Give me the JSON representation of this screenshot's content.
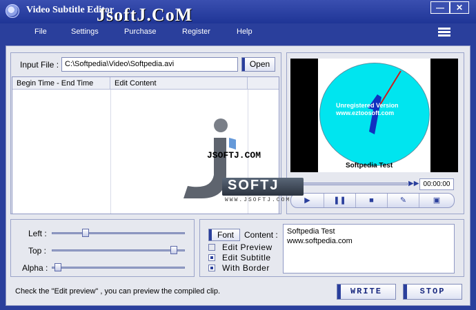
{
  "window": {
    "title": "Video Subtitle Editor",
    "watermark": "JsoftJ.CoM",
    "minimize_glyph": "—",
    "close_glyph": "✕"
  },
  "menu": {
    "items": [
      "File",
      "Settings",
      "Purchase",
      "Register",
      "Help"
    ]
  },
  "input": {
    "label": "Input File :",
    "value": "C:\\Softpedia\\Video\\Softpedia.avi",
    "open_label": "Open"
  },
  "table": {
    "columns": [
      "Begin Time - End Time",
      "Edit Content"
    ],
    "rows": []
  },
  "video": {
    "overlay_line1": "Unregistered Version",
    "overlay_line2": "www.eztoosoft.com",
    "caption": "Softpedia Test",
    "time": "00:00:00"
  },
  "watermark_logo": {
    "line1": "JSOFTJ.COM",
    "line2": "SOFTJ",
    "line3": "WWW.JSOFTJ.COM"
  },
  "sliders": {
    "left": {
      "label": "Left :",
      "value": 0.25
    },
    "top": {
      "label": "Top :",
      "value": 0.92
    },
    "alpha": {
      "label": "Alpha :",
      "value": 0.03
    }
  },
  "options": {
    "font_label": "Font",
    "content_label": "Content :",
    "content_lines": [
      "Softpedia Test",
      "www.softpedia.com"
    ],
    "edit_preview": {
      "label": "Edit Preview",
      "checked": false
    },
    "edit_subtitle": {
      "label": "Edit Subtitle",
      "checked": true
    },
    "with_border": {
      "label": "With Border",
      "checked": true
    }
  },
  "status": {
    "hint": "Check the \"Edit preview\" , you can preview the compiled clip."
  },
  "actions": {
    "write_label": "WRITE",
    "stop_label": "STOP"
  },
  "colors": {
    "frame": "#2a3f9c",
    "panel": "#e6e8ef",
    "clock_face": "#00e5ef"
  }
}
